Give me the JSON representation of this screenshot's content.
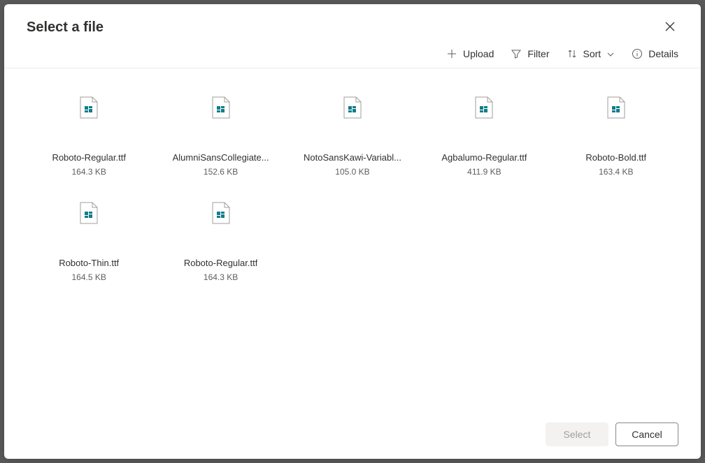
{
  "header": {
    "title": "Select a file"
  },
  "toolbar": {
    "upload_label": "Upload",
    "filter_label": "Filter",
    "sort_label": "Sort",
    "details_label": "Details"
  },
  "files": [
    {
      "name": "Roboto-Regular.ttf",
      "size": "164.3 KB"
    },
    {
      "name": "AlumniSansCollegiate...",
      "size": "152.6 KB"
    },
    {
      "name": "NotoSansKawi-Variabl...",
      "size": "105.0 KB"
    },
    {
      "name": "Agbalumo-Regular.ttf",
      "size": "411.9 KB"
    },
    {
      "name": "Roboto-Bold.ttf",
      "size": "163.4 KB"
    },
    {
      "name": "Roboto-Thin.ttf",
      "size": "164.5 KB"
    },
    {
      "name": "Roboto-Regular.ttf",
      "size": "164.3 KB"
    }
  ],
  "footer": {
    "select_label": "Select",
    "cancel_label": "Cancel"
  }
}
